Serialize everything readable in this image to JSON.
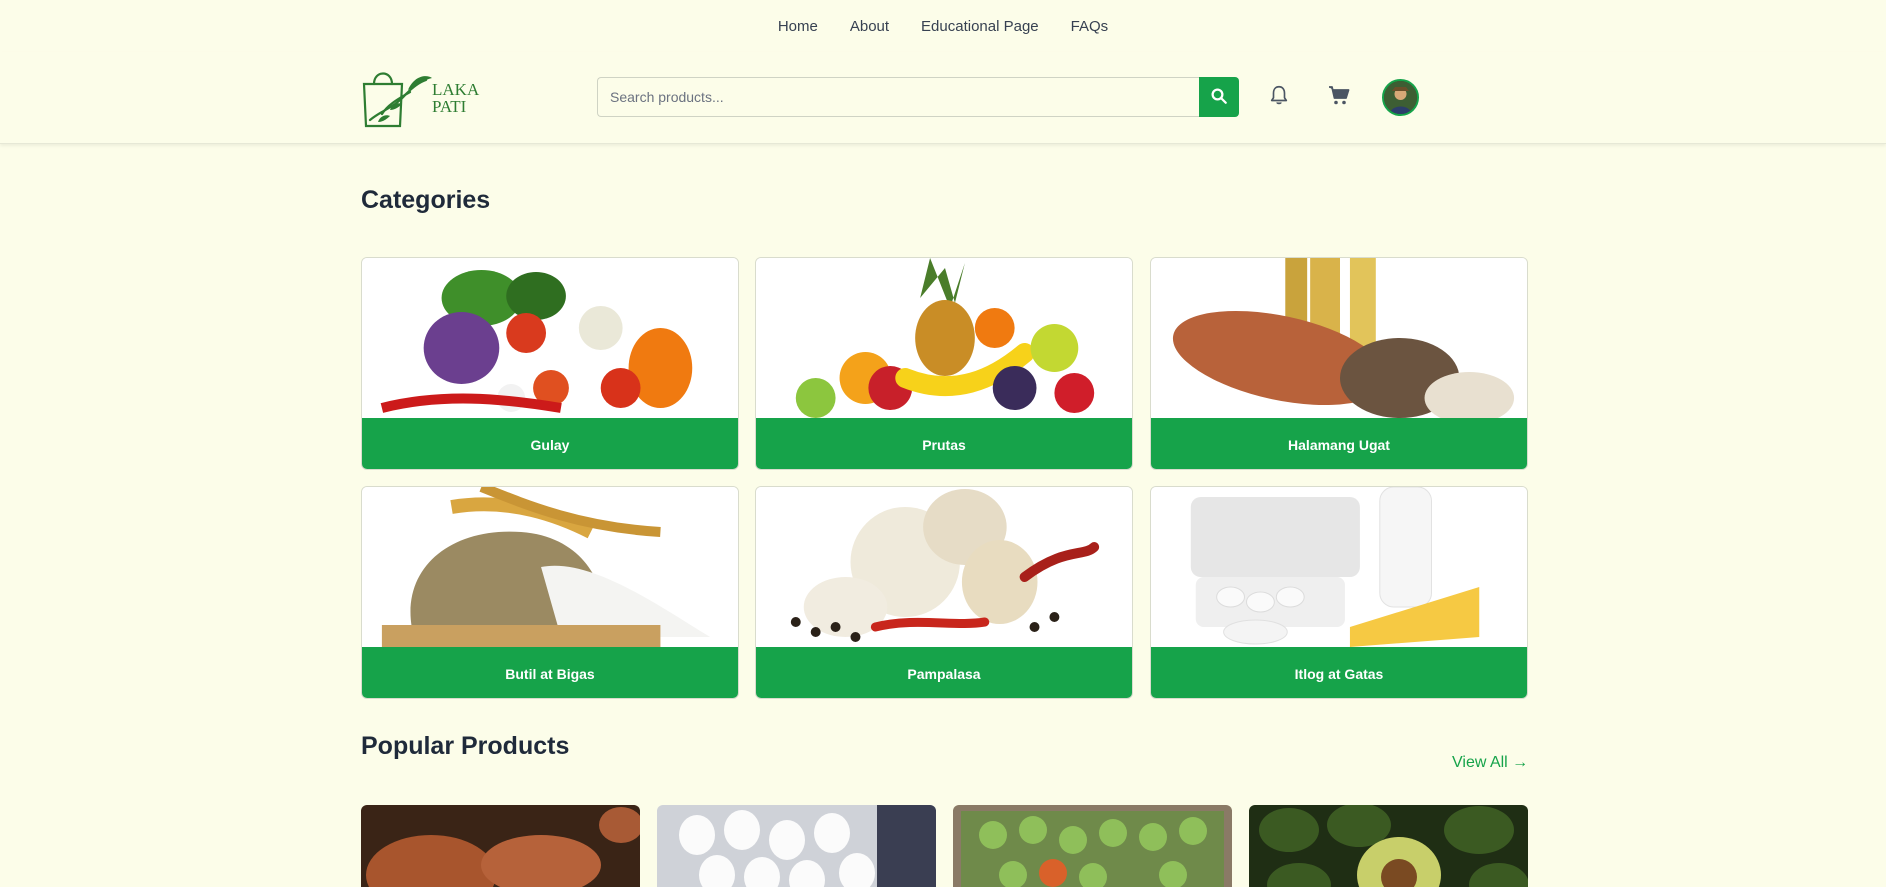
{
  "topnav": {
    "items": [
      "Home",
      "About",
      "Educational Page",
      "FAQs"
    ]
  },
  "header": {
    "logo_text": "LAKA PATI",
    "search": {
      "placeholder": "Search products...",
      "value": ""
    },
    "icons": {
      "search": "search-icon",
      "notifications": "bell-icon",
      "cart": "cart-icon",
      "profile": "avatar"
    }
  },
  "categories": {
    "title": "Categories",
    "items": [
      {
        "label": "Gulay"
      },
      {
        "label": "Prutas"
      },
      {
        "label": "Halamang Ugat"
      },
      {
        "label": "Butil at Bigas"
      },
      {
        "label": "Pampalasa"
      },
      {
        "label": "Itlog at Gatas"
      }
    ]
  },
  "popular": {
    "title": "Popular Products",
    "view_all": "View All →"
  },
  "colors": {
    "accent": "#16a34a",
    "background": "#fcfde9",
    "heading": "#1f2a3a"
  }
}
